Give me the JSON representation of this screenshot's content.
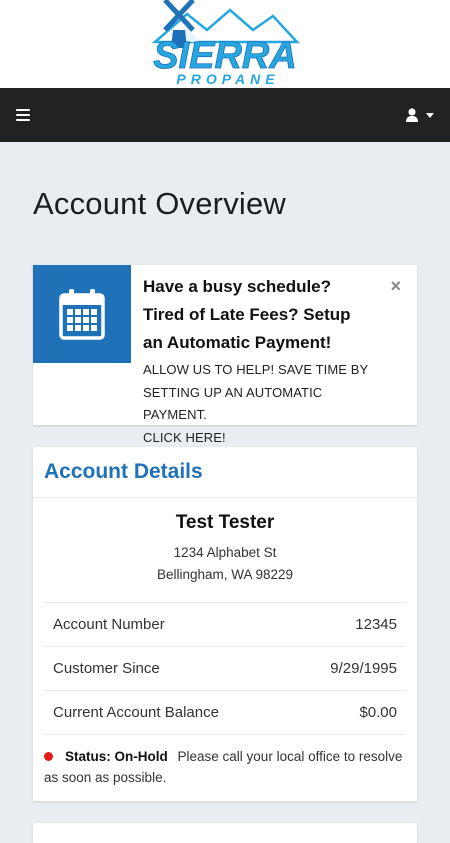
{
  "brand": {
    "logo_top": "SIERRA",
    "logo_bottom": "PROPANE",
    "colors": {
      "logo": "#27a7e0",
      "primary": "#1f72b8",
      "navbar": "#222222",
      "status": "#e41b1b"
    }
  },
  "navbar": {
    "menu_icon": "hamburger-icon",
    "user_icon": "user-icon"
  },
  "page": {
    "title": "Account Overview"
  },
  "promo": {
    "icon": "calendar-icon",
    "heading_line1": "Have a busy schedule?",
    "heading_line2": "Tired of Late Fees? Setup",
    "heading_line3": "an Automatic Payment!",
    "body_line1": "ALLOW US TO HELP! SAVE TIME BY",
    "body_line2": "SETTING UP AN AUTOMATIC PAYMENT.",
    "body_line3": "CLICK HERE!",
    "close_symbol": "×"
  },
  "account": {
    "header": "Account Details",
    "name": "Test Tester",
    "address_line1": "1234 Alphabet St",
    "address_line2": "Bellingham, WA 98229",
    "rows": [
      {
        "label": "Account Number",
        "value": "12345"
      },
      {
        "label": "Customer Since",
        "value": "9/29/1995"
      },
      {
        "label": "Current Account Balance",
        "value": "$0.00"
      }
    ],
    "status_label": "Status: On-Hold",
    "status_message": "Please call your local office to resolve as soon as possible."
  }
}
